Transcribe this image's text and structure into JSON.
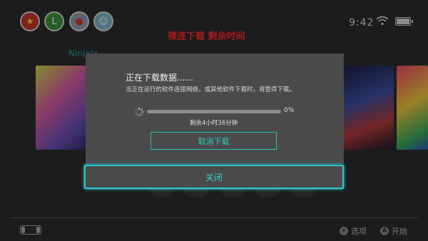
{
  "status": {
    "time": "9:42"
  },
  "avatars": [
    {
      "icon": "star-avatar-icon",
      "color": "#c9342e",
      "glyph": "★"
    },
    {
      "icon": "green-hat-avatar-icon",
      "color": "#3e8f3a",
      "glyph": "L"
    },
    {
      "icon": "mushroom-avatar-icon",
      "color": "#8a9bb0",
      "glyph": "●"
    },
    {
      "icon": "character-avatar-icon",
      "color": "#7fb3c8",
      "glyph": "☺"
    }
  ],
  "overlay_caption": "裸连下载 剩余时间",
  "game_name": "Ninjala",
  "dialog": {
    "title": "正在下载数据......",
    "message": "当正在运行的软件连接网络，或其他软件下载时，将暂停下载。",
    "progress_fraction": 0,
    "percent_text": "0%",
    "remaining": "剩余4小时36分钟",
    "cancel_label": "取消下载"
  },
  "close_label": "关闭",
  "footer": {
    "options_label": "选项",
    "options_button": "+",
    "start_label": "开始",
    "start_button": "A"
  },
  "colors": {
    "accent": "#2fc6cf",
    "alert": "#ff2828"
  }
}
